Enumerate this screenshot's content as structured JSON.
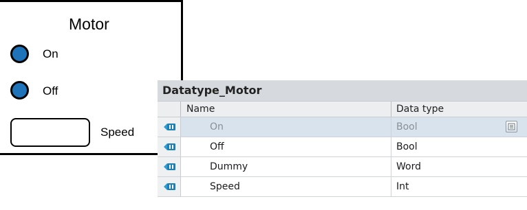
{
  "faceplate": {
    "title": "Motor",
    "indicators": [
      {
        "label": "On",
        "color": "#1f73b8"
      },
      {
        "label": "Off",
        "color": "#1f73b8"
      }
    ],
    "speed_label": "Speed"
  },
  "datatype": {
    "title": "Datatype_Motor",
    "columns": {
      "name": "Name",
      "data_type": "Data type"
    },
    "rows": [
      {
        "name": "On",
        "type": "Bool",
        "icon": "static-member-icon",
        "selected": true
      },
      {
        "name": "Off",
        "type": "Bool",
        "icon": "static-member-icon",
        "selected": false
      },
      {
        "name": "Dummy",
        "type": "Word",
        "icon": "static-member-icon",
        "selected": false
      },
      {
        "name": "Speed",
        "type": "Int",
        "icon": "static-member-icon",
        "selected": false
      }
    ]
  }
}
